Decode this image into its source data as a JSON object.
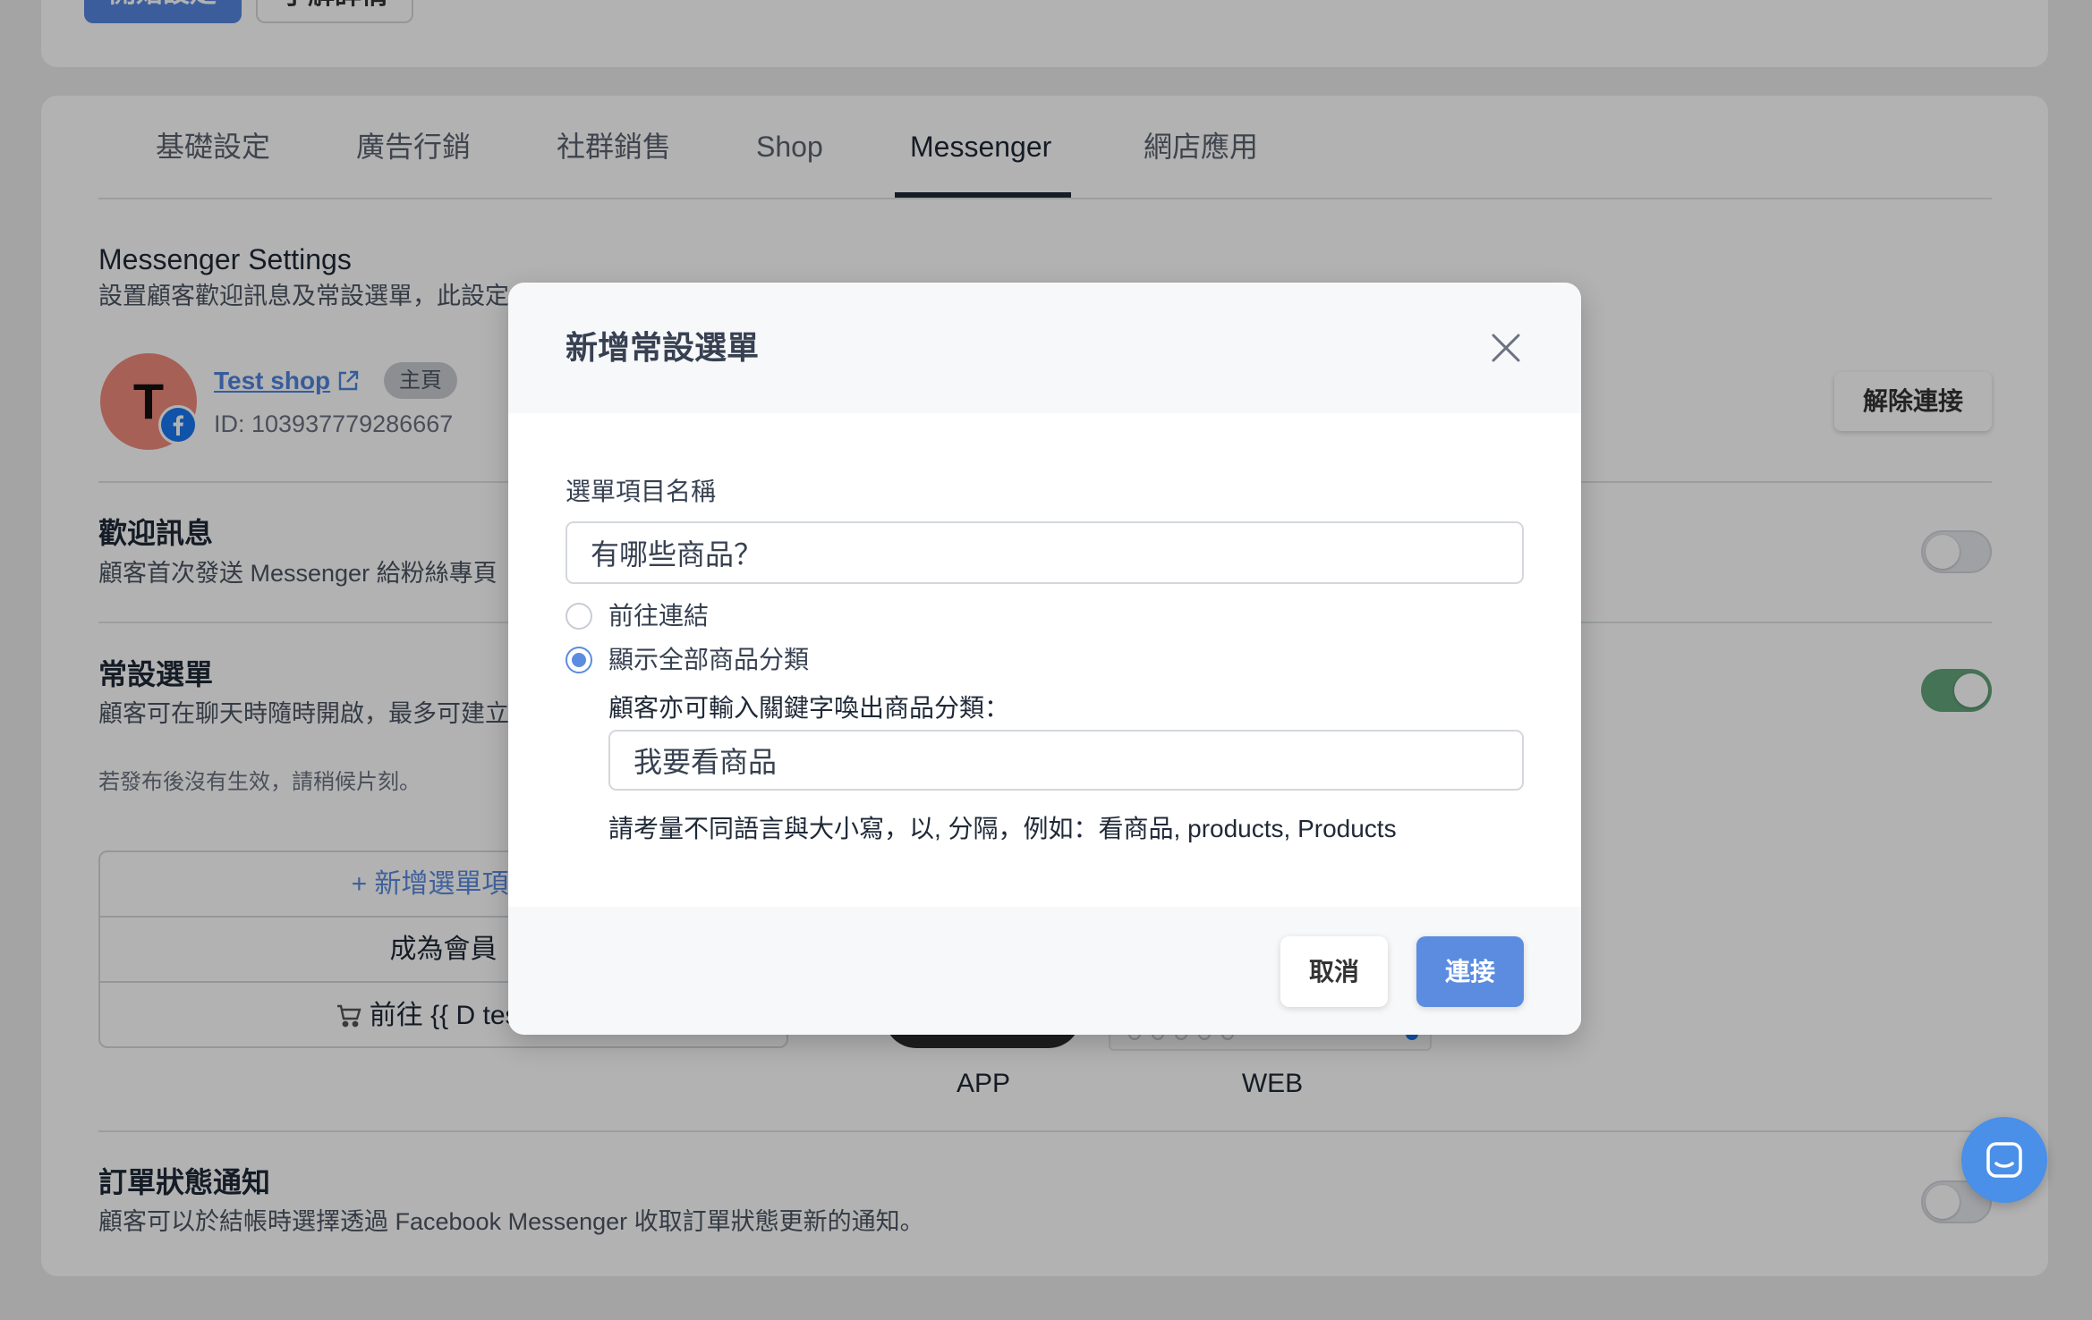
{
  "top_card": {
    "primary_button": "開始設定",
    "secondary_button": "了解詳情"
  },
  "tabs": [
    {
      "label": "基礎設定",
      "active": false
    },
    {
      "label": "廣告行銷",
      "active": false
    },
    {
      "label": "社群銷售",
      "active": false
    },
    {
      "label": "Shop",
      "active": false
    },
    {
      "label": "Messenger",
      "active": true
    },
    {
      "label": "網店應用",
      "active": false
    }
  ],
  "settings": {
    "title": "Messenger Settings",
    "subtitle": "設置顧客歡迎訊息及常設選單，此設定"
  },
  "page_account": {
    "avatar_letter": "T",
    "name": "Test shop",
    "badge": "主頁",
    "id": "ID: 103937779286667",
    "disconnect_label": "解除連接"
  },
  "welcome": {
    "title": "歡迎訊息",
    "description": "顧客首次發送 Messenger 給粉絲專頁",
    "enabled": false
  },
  "persistent_menu": {
    "title": "常設選單",
    "description": "顧客可在聊天時隨時開啟，最多可建立",
    "enabled": true,
    "note": "若發布後沒有生效，請稍候片刻。",
    "add_item": "+ 新增選單項目",
    "items": [
      "成為會員",
      "前往 {{ D test }}"
    ]
  },
  "preview": {
    "app_label": "APP",
    "web_label": "WEB"
  },
  "order_notification": {
    "title": "訂單狀態通知",
    "description": "顧客可以於結帳時選擇透過 Facebook Messenger 收取訂單狀態更新的通知。",
    "enabled": false
  },
  "modal": {
    "title": "新增常設選單",
    "item_name_label": "選單項目名稱",
    "item_name_value": "有哪些商品？",
    "options": [
      {
        "label": "前往連結",
        "selected": false
      },
      {
        "label": "顯示全部商品分類",
        "selected": true
      }
    ],
    "keyword_label": "顧客亦可輸入關鍵字喚出商品分類：",
    "keyword_value": "我要看商品",
    "keyword_help": "請考量不同語言與大小寫，以, 分隔，例如：看商品, products, Products",
    "cancel_label": "取消",
    "confirm_label": "連接"
  },
  "colors": {
    "accent": "#5b8ce0",
    "link": "#4f85e0",
    "toggle_on": "#63a57b",
    "chat_fab": "#4a8fe8"
  }
}
